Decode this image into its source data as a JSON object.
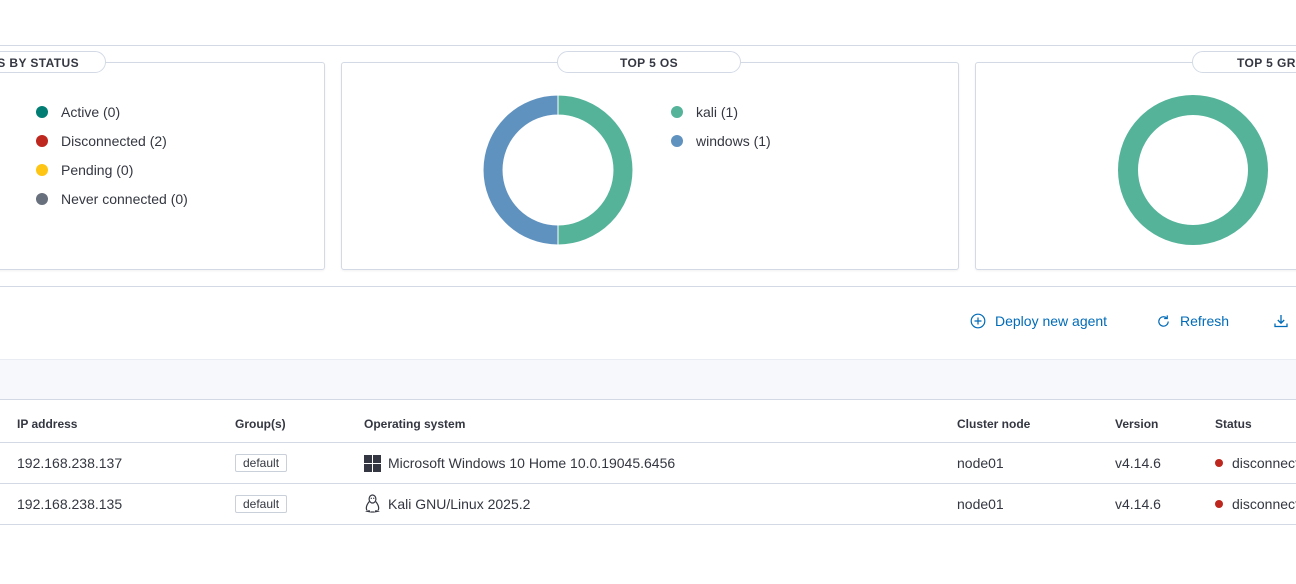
{
  "panels": {
    "status": {
      "title": "S BY STATUS",
      "legend": [
        {
          "label": "Active (0)",
          "color": "#017d73"
        },
        {
          "label": "Disconnected (2)",
          "color": "#bd271e"
        },
        {
          "label": "Pending (0)",
          "color": "#fec514"
        },
        {
          "label": "Never connected (0)",
          "color": "#69707d"
        }
      ]
    },
    "os": {
      "title": "TOP 5 OS",
      "legend": [
        {
          "label": "kali (1)",
          "color": "#54b399"
        },
        {
          "label": "windows (1)",
          "color": "#6092c0"
        }
      ]
    },
    "groups": {
      "title": "TOP 5 GR"
    }
  },
  "chart_data": [
    {
      "type": "pie",
      "title": "TOP 5 OS",
      "categories": [
        "kali",
        "windows"
      ],
      "values": [
        1,
        1
      ],
      "colors": [
        "#54b399",
        "#6092c0"
      ]
    },
    {
      "type": "pie",
      "title": "TOP 5 GR",
      "categories": [
        "default"
      ],
      "values": [
        2
      ],
      "colors": [
        "#54b399"
      ]
    }
  ],
  "actions": {
    "deploy_label": "Deploy new agent",
    "refresh_label": "Refresh"
  },
  "table": {
    "columns": [
      "IP address",
      "Group(s)",
      "Operating system",
      "Cluster node",
      "Version",
      "Status"
    ],
    "rows": [
      {
        "ip": "192.168.238.137",
        "group": "default",
        "os": "Microsoft Windows 10 Home 10.0.19045.6456",
        "os_icon": "windows-icon",
        "node": "node01",
        "version": "v4.14.6",
        "status": "disconnected",
        "status_color": "#bd271e"
      },
      {
        "ip": "192.168.238.135",
        "group": "default",
        "os": "Kali GNU/Linux 2025.2",
        "os_icon": "linux-icon",
        "node": "node01",
        "version": "v4.14.6",
        "status": "disconnected",
        "status_color": "#bd271e"
      }
    ]
  }
}
